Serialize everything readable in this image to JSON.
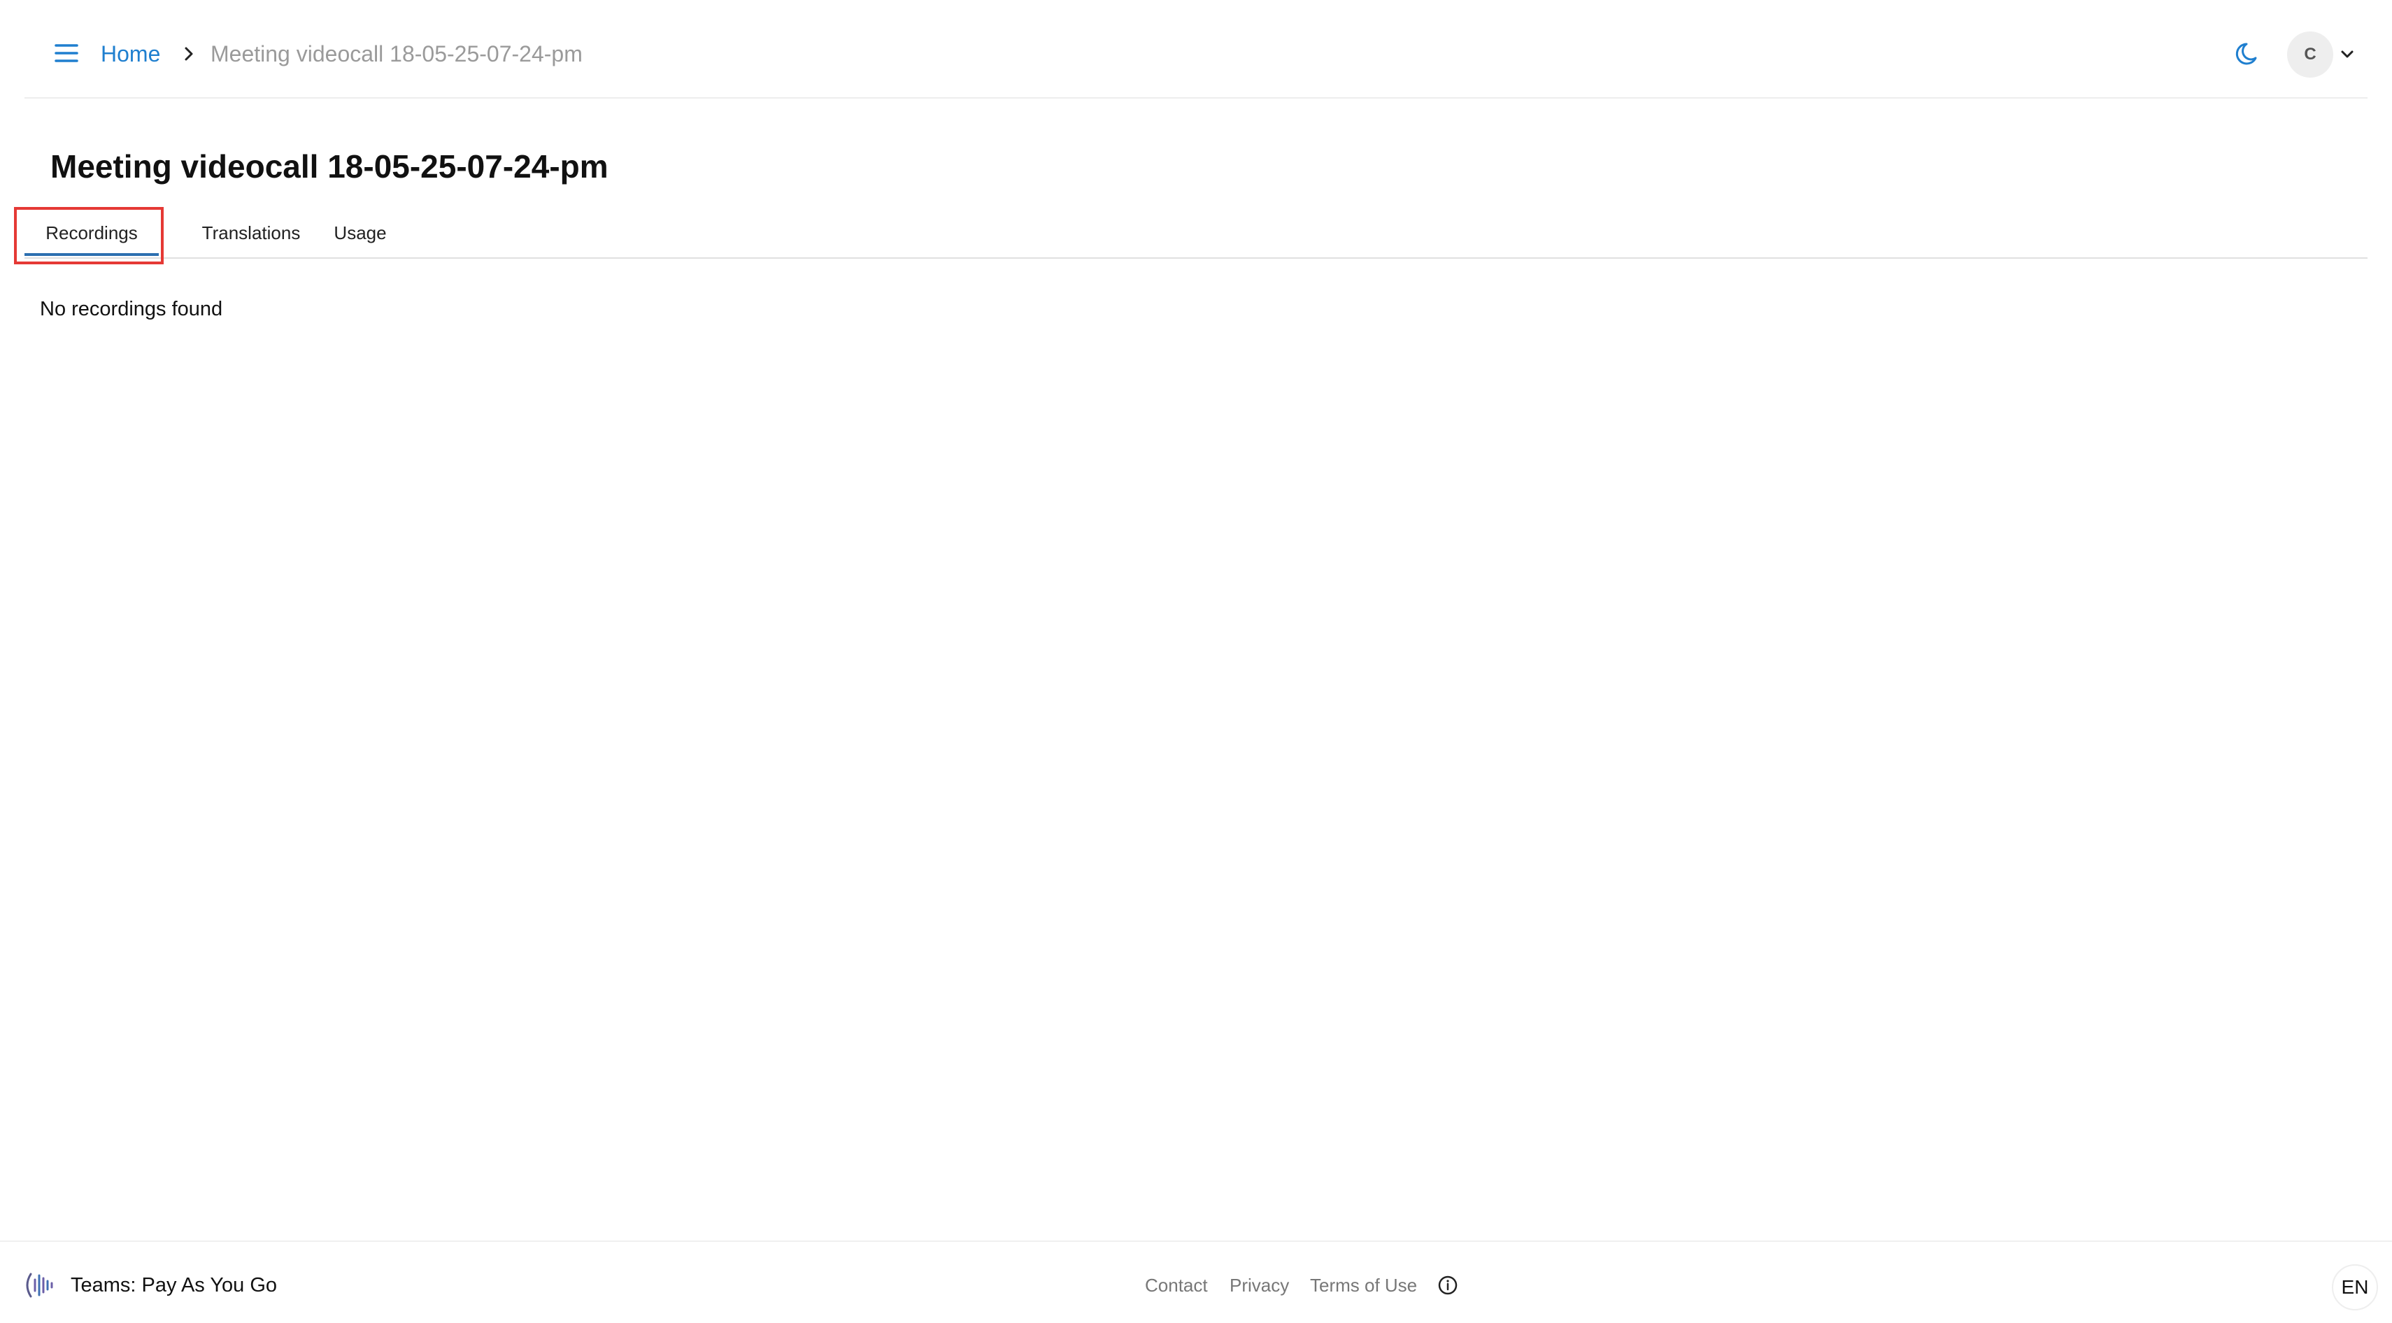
{
  "header": {
    "menu_icon": "hamburger-menu-icon",
    "breadcrumb": {
      "home_label": "Home",
      "separator_icon": "chevron-right-icon",
      "current_label": "Meeting videocall 18-05-25-07-24-pm"
    },
    "theme_toggle_icon": "moon-icon",
    "user": {
      "avatar_initial": "C",
      "dropdown_icon": "chevron-down-icon"
    }
  },
  "main": {
    "title": "Meeting videocall 18-05-25-07-24-pm",
    "tabs": [
      {
        "label": "Recordings",
        "active": true
      },
      {
        "label": "Translations",
        "active": false
      },
      {
        "label": "Usage",
        "active": false
      }
    ],
    "empty_message": "No recordings found"
  },
  "footer": {
    "brand_logo_icon": "brand-logo-icon",
    "brand_name": "Teams: Pay As You Go",
    "links": [
      {
        "label": "Contact"
      },
      {
        "label": "Privacy"
      },
      {
        "label": "Terms of Use"
      }
    ],
    "info_icon": "info-circle-icon",
    "language": "EN"
  },
  "colors": {
    "accent": "#1f7fcf",
    "tab_underline": "#2c6fb0",
    "highlight": "#e53935",
    "muted_text": "#9a9a9a"
  }
}
